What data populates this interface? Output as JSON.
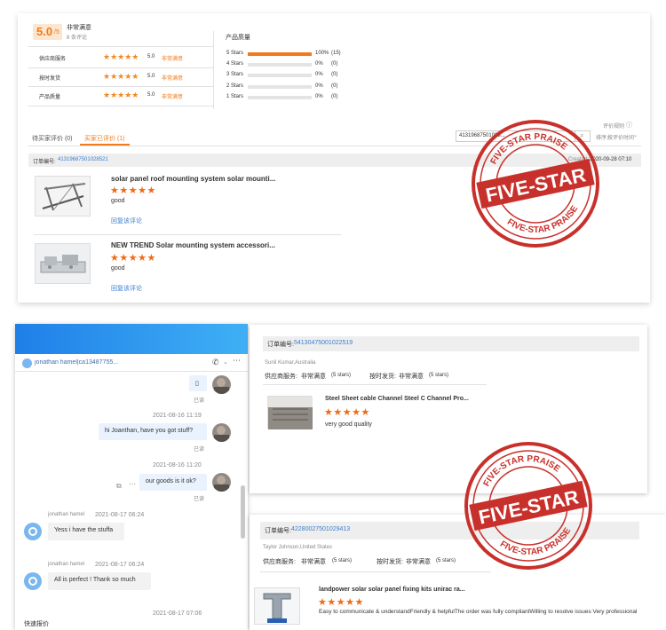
{
  "top_panel": {
    "score": "5.0",
    "score_suffix": "/5",
    "score_label": "非常满意",
    "review_count": "8 条评论",
    "ratings": [
      {
        "label": "供应商服务",
        "score": "5.0",
        "verdict": "非常满意"
      },
      {
        "label": "按时发货",
        "score": "5.0",
        "verdict": "非常满意"
      },
      {
        "label": "产品质量",
        "score": "5.0",
        "verdict": "非常满意"
      }
    ],
    "quality_title": "产品质量",
    "star_breakdown": [
      {
        "label": "5 Stars",
        "pct_text": "100%",
        "count": "(15)",
        "fraction": 1.0
      },
      {
        "label": "4 Stars",
        "pct_text": "0%",
        "count": "(0)",
        "fraction": 0
      },
      {
        "label": "3 Stars",
        "pct_text": "0%",
        "count": "(0)",
        "fraction": 0
      },
      {
        "label": "2 Stars",
        "pct_text": "0%",
        "count": "(0)",
        "fraction": 0
      },
      {
        "label": "1 Stars",
        "pct_text": "0%",
        "count": "(0)",
        "fraction": 0
      }
    ],
    "rules_link": "评价规则",
    "tabs": [
      {
        "label": "待买家评价 (0)",
        "active": false
      },
      {
        "label": "买家已评价 (1)",
        "active": true
      }
    ],
    "search_value": "41319687501028...",
    "sort_label": "排序：",
    "sort_value": "按评价时间",
    "order_label": "订单编号:",
    "order_number": "41319687501028521",
    "created_label": "Created:",
    "created_value": "2020-09-28 07:10",
    "items": [
      {
        "title": "solar panel roof mounting system solar mounti...",
        "stars": "★★★★★",
        "comment": "good",
        "reply_link": "回复该评论"
      },
      {
        "title": "NEW TREND Solar mounting system accessori...",
        "stars": "★★★★★",
        "comment": "good",
        "reply_link": "回复该评论"
      }
    ]
  },
  "chat": {
    "contact": "jonathan hamel|ca13487755...",
    "messages": [
      {
        "side": "right",
        "text": "▯",
        "status": "已读"
      },
      {
        "side": "right",
        "time": "2021-08-16 11:19",
        "text": "hi Joanthan, have you got stuff?",
        "status": "已读"
      },
      {
        "side": "right",
        "time": "2021-08-16 11:20",
        "text": "our goods is it ok?",
        "status": "已读"
      },
      {
        "side": "left",
        "sender": "jonathan hamel",
        "time": "2021-08-17 06:24",
        "text": "Yess i have the stuffa"
      },
      {
        "side": "left",
        "sender": "jonathan hamel",
        "time": "2021-08-17 06:24",
        "text": "All is perfect ! Thank so much"
      },
      {
        "side": "right",
        "time": "2021-08-17 07:06"
      }
    ],
    "quick_quote": "快速报价"
  },
  "review2": {
    "order_label": "订单编号:",
    "order_number": "54130475001022519",
    "buyer": "Sunil Kumar,Australia",
    "service_label": "供应商服务:",
    "service_value": "非常满意",
    "service_stars": "(5 stars)",
    "delivery_label": "按时发货:",
    "delivery_value": "非常满意",
    "delivery_stars": "(5 stars)",
    "item_title": "Steel Sheet cable Channel Steel C Channel Pro...",
    "stars": "★★★★★",
    "comment": "very good quality"
  },
  "review3": {
    "order_label": "订单编号:",
    "order_number": "42280027501029413",
    "buyer": "Taylor Johnson,United States",
    "service_label": "供应商服务:",
    "service_value": "非常满意",
    "service_stars": "(5 stars)",
    "delivery_label": "按时发货:",
    "delivery_value": "非常满意",
    "delivery_stars": "(5 stars)",
    "item_title": "landpower solar solar panel fixing kits unirac ra...",
    "stars": "★★★★★",
    "comment": "Easy to communicate & understandFriendly & helpfulThe order was fully compliantWilling to resolve issues Very professional"
  },
  "stamp": {
    "top_text": "FIVE-STAR PRAISE",
    "bottom_text": "FIVE-STAR PRAISE",
    "center_text": "FIVE-STAR",
    "color": "#c8312b"
  }
}
